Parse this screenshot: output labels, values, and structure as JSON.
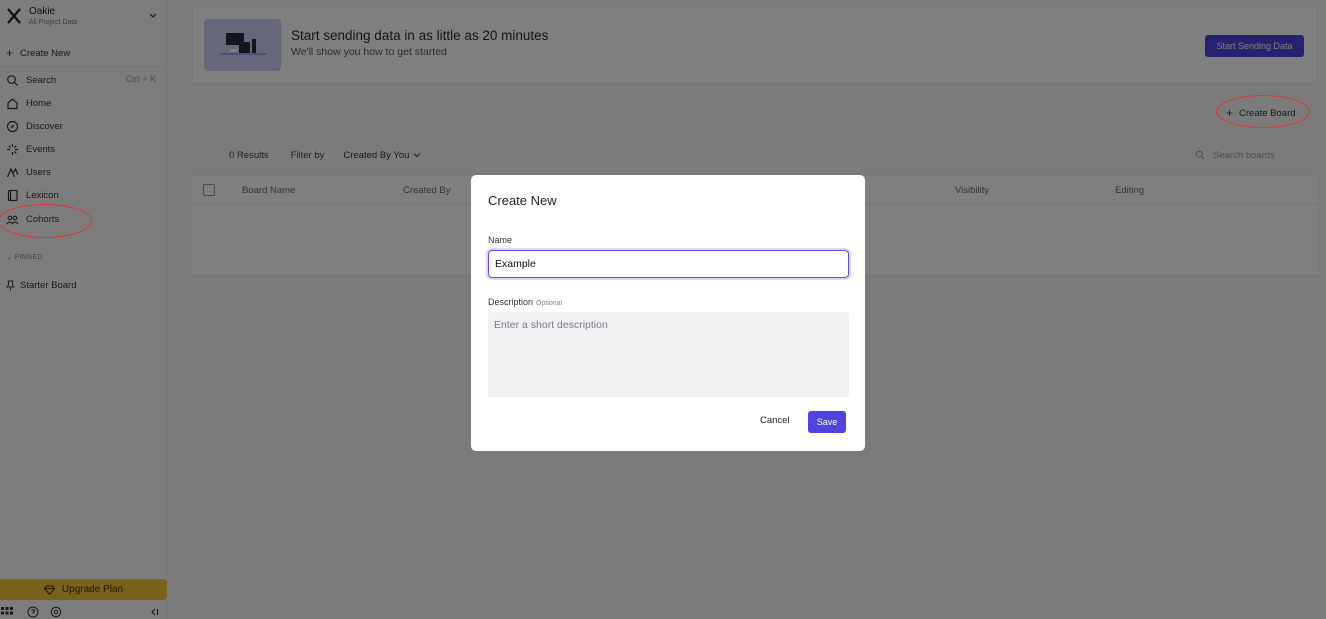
{
  "workspace": {
    "name": "Oakie",
    "subtitle": "All Project Data"
  },
  "sidebar": {
    "create_new": "Create New",
    "search": {
      "label": "Search",
      "shortcut": "Ctrl + K"
    },
    "items": [
      {
        "label": "Home",
        "icon": "home-icon"
      },
      {
        "label": "Discover",
        "icon": "compass-icon"
      },
      {
        "label": "Events",
        "icon": "events-icon"
      },
      {
        "label": "Users",
        "icon": "users-icon"
      },
      {
        "label": "Lexicon",
        "icon": "book-icon"
      },
      {
        "label": "Cohorts",
        "icon": "cohorts-icon"
      }
    ],
    "pinned_heading": "PINNED",
    "pinned_items": [
      {
        "label": "Starter Board"
      }
    ],
    "upgrade_label": "Upgrade Plan"
  },
  "banner": {
    "title": "Start sending data in as little as 20 minutes",
    "subtitle": "We'll show you how to get started",
    "button": "Start Sending Data"
  },
  "boards": {
    "create_board": "Create Board",
    "results": "0 Results",
    "filter_label": "Filter by",
    "filter_value": "Created By You",
    "search_placeholder": "Search boards",
    "columns": [
      "Board Name",
      "Created By",
      "Visibility",
      "Editing"
    ]
  },
  "modal": {
    "title": "Create New",
    "name_label": "Name",
    "name_value": "Example",
    "description_label": "Description",
    "description_optional": "Optional",
    "description_placeholder": "Enter a short description",
    "cancel": "Cancel",
    "save": "Save"
  },
  "colors": {
    "accent": "#4f44e0",
    "upgrade": "#f3c433",
    "annotation": "#e3332f"
  }
}
